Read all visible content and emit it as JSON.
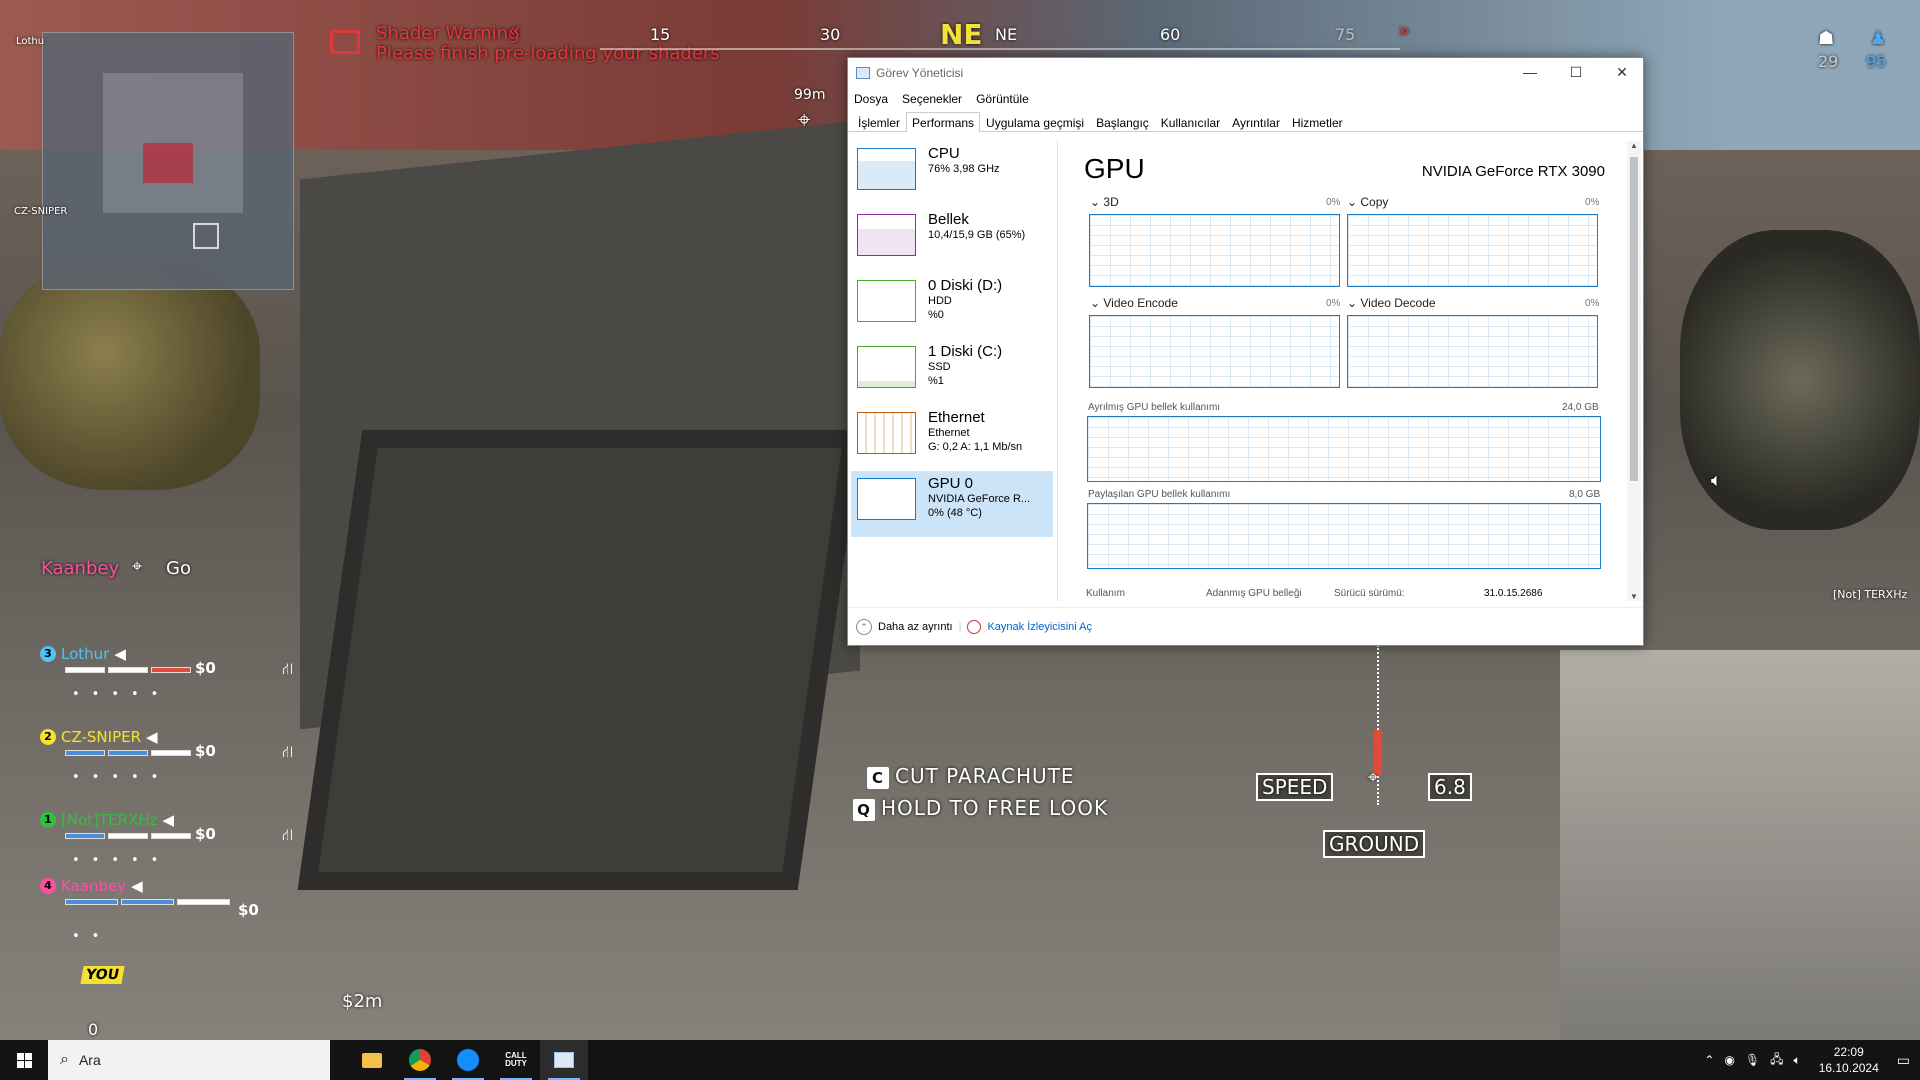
{
  "game": {
    "shader_warning_title": "Shader Warning",
    "shader_warning_text": "Please finish pre-loading your shaders",
    "compass": {
      "dir": "NE",
      "marks": [
        "15",
        "30",
        "NE",
        "60",
        "75"
      ]
    },
    "waypoint_distance": "99m",
    "top_right": {
      "left_value": "29",
      "right_value": "95"
    },
    "minimap_labels": [
      "Lothu",
      "CZ-SNIPER"
    ],
    "ping": {
      "player": "Kaanbey",
      "label": "Go"
    },
    "team": [
      {
        "num": "3",
        "name": "Lothur",
        "cash": "$0",
        "color": "#4fc3f7"
      },
      {
        "num": "2",
        "name": "CZ-SNIPER",
        "cash": "$0",
        "color": "#f5e12e"
      },
      {
        "num": "1",
        "name": "[Not]TERXHz",
        "cash": "$0",
        "color": "#30c040"
      },
      {
        "num": "4",
        "name": "Kaanbey",
        "cash": "$0",
        "color": "#ff4fa3"
      }
    ],
    "you_label": "YOU",
    "you_zero": "0",
    "money_value": "$2m",
    "prompts": [
      {
        "key": "C",
        "text": "CUT PARACHUTE"
      },
      {
        "key": "Q",
        "text": "HOLD TO FREE LOOK"
      }
    ],
    "speed_label": "SPEED",
    "speed_value": "6.8",
    "ground_label": "GROUND",
    "right_player_name": "[Not] TERXHz"
  },
  "taskmanager": {
    "title": "Görev Yöneticisi",
    "menu": [
      "Dosya",
      "Seçenekler",
      "Görüntüle"
    ],
    "tabs": [
      "İşlemler",
      "Performans",
      "Uygulama geçmişi",
      "Başlangıç",
      "Kullanıcılar",
      "Ayrıntılar",
      "Hizmetler"
    ],
    "active_tab": "Performans",
    "items": [
      {
        "title": "CPU",
        "sub1": "76%  3,98 GHz",
        "sub2": "",
        "sub3": "",
        "color": "#1a7bc4"
      },
      {
        "title": "Bellek",
        "sub1": "10,4/15,9 GB (65%)",
        "sub2": "",
        "sub3": "",
        "color": "#8b2e9e"
      },
      {
        "title": "0 Diski (D:)",
        "sub1": "HDD",
        "sub2": "%0",
        "sub3": "",
        "color": "#4ba82e"
      },
      {
        "title": "1 Diski (C:)",
        "sub1": "SSD",
        "sub2": "%1",
        "sub3": "",
        "color": "#4ba82e"
      },
      {
        "title": "Ethernet",
        "sub1": "Ethernet",
        "sub2": "G: 0,2  A: 1,1 Mb/sn",
        "sub3": "",
        "color": "#b35c12"
      },
      {
        "title": "GPU 0",
        "sub1": "NVIDIA GeForce R...",
        "sub2": "0% (48 °C)",
        "sub3": "",
        "color": "#1a7bc4"
      }
    ],
    "gpu_heading": "GPU",
    "gpu_name": "NVIDIA GeForce RTX 3090",
    "engines": [
      {
        "label": "3D",
        "pct": "0%"
      },
      {
        "label": "Copy",
        "pct": "0%"
      },
      {
        "label": "Video Encode",
        "pct": "0%"
      },
      {
        "label": "Video Decode",
        "pct": "0%"
      }
    ],
    "dedicated_label": "Ayrılmış GPU bellek kullanımı",
    "dedicated_max": "24,0 GB",
    "shared_label": "Paylaşılan GPU bellek kullanımı",
    "shared_max": "8,0 GB",
    "bottom_labels": [
      "Kullanım",
      "Adanmış GPU belleği",
      "Sürücü sürümü:",
      "31.0.15.2686"
    ],
    "fewer_details": "Daha az ayrıntı",
    "resource_monitor": "Kaynak İzleyicisini Aç"
  },
  "taskbar": {
    "search_placeholder": "Ara",
    "time": "22:09",
    "date": "16.10.2024"
  }
}
